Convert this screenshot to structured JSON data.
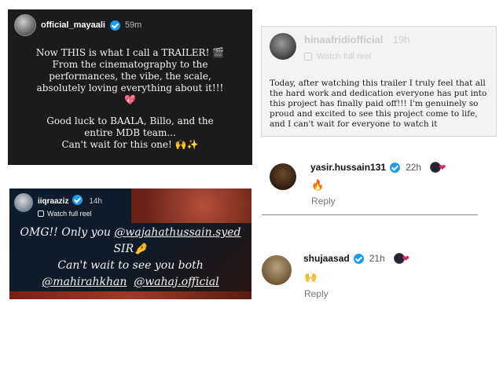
{
  "card1": {
    "username": "official_mayaali",
    "time": "59m",
    "lines": [
      "Now THIS is what I call a TRAILER! 🎬",
      "From the cinematography to the",
      "performances, the vibe, the scale,",
      "absolutely loving everything about it!!!",
      "💖"
    ],
    "lines2": [
      "Good luck to BAALA, Billo, and the",
      "entire MDB team...",
      "Can't wait for this one! 🙌✨"
    ]
  },
  "card2": {
    "username": "hinaafridiofficial",
    "time": "19h",
    "reel_label": "Watch full reel",
    "body": "Today, after watching this trailer I truly feel that all the hard work and dedication everyone has put into this project has finally paid off!!! I'm genuinely so proud and excited to see this project come to life, and I can't wait for everyone to watch it"
  },
  "comment1": {
    "username": "yasir.hussain131",
    "time": "22h",
    "emoji": "🔥",
    "reply_label": "Reply"
  },
  "comment2": {
    "username": "shujaasad",
    "time": "21h",
    "emoji": "🙌",
    "reply_label": "Reply"
  },
  "card3": {
    "username": "iiqraaziz",
    "time": "14h",
    "reel_label": "Watch full reel",
    "line1_prefix": "OMG!! Only you ",
    "mention1": "@wajahathussain.syed",
    "line2": "SIR🤌",
    "line3": "Can't wait to see you both",
    "mention2": "@mahirahkhan",
    "mention3": "@wahaj.official"
  },
  "colors": {
    "verified": "#1d9bf0",
    "heart": "#e0245e"
  }
}
